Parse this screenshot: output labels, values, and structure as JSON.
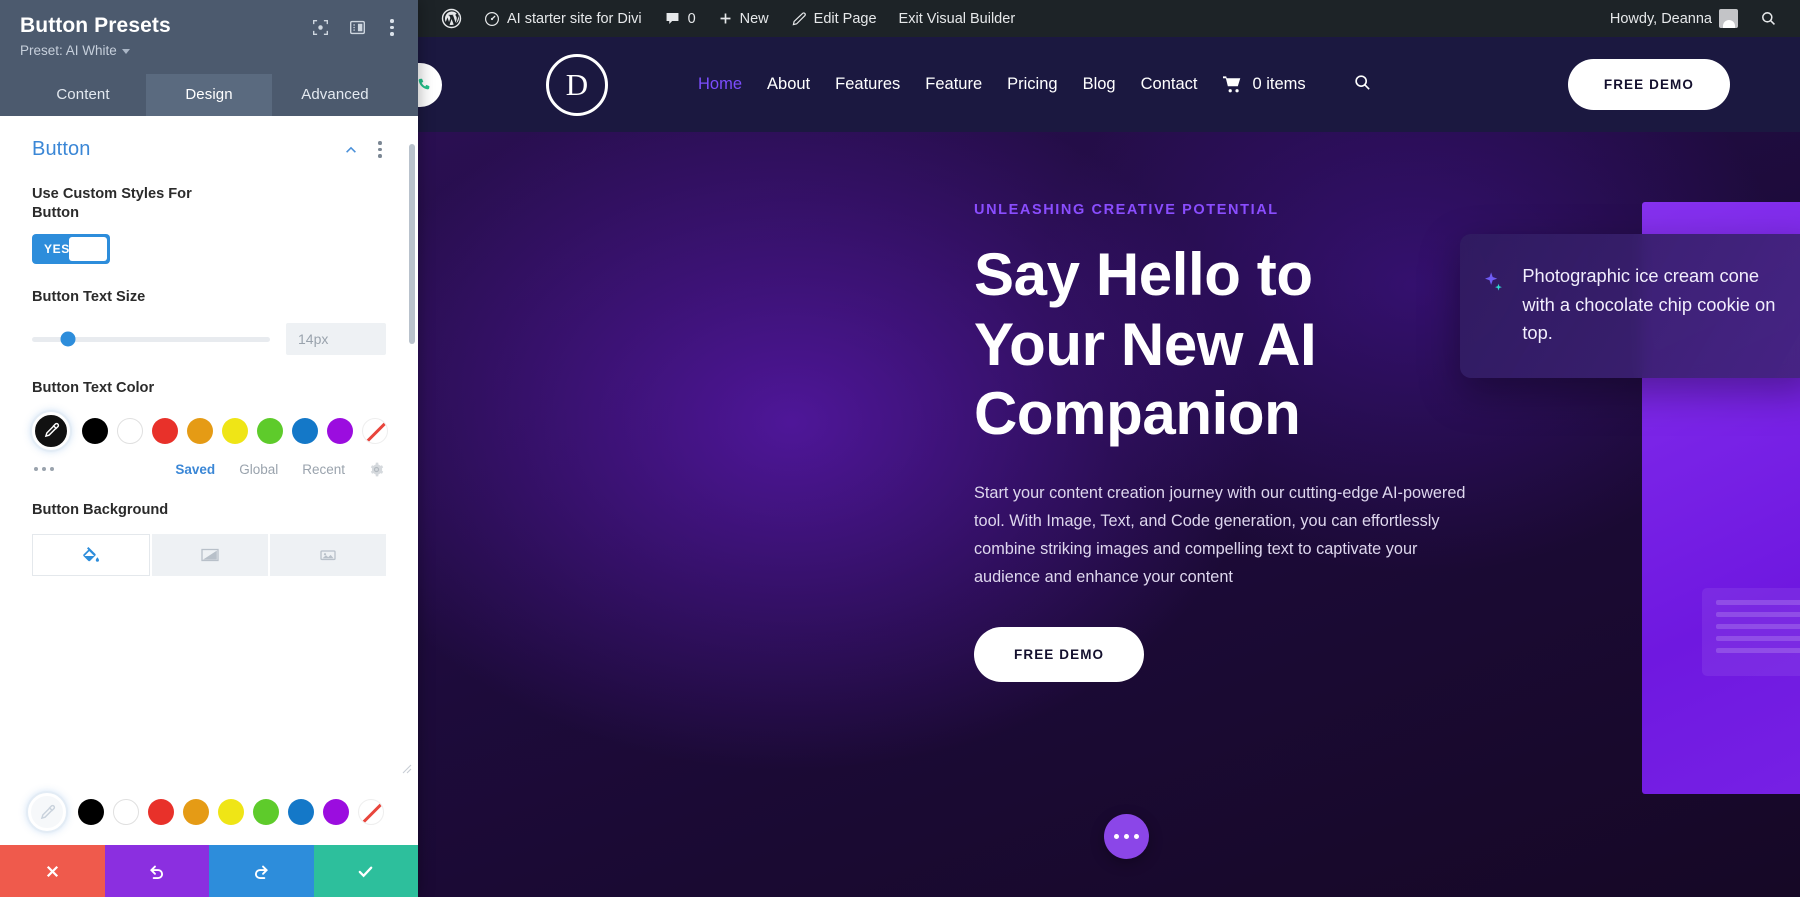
{
  "panel": {
    "title": "Button Presets",
    "preset_label": "Preset: AI White",
    "icons": {
      "focus": "focus-target-icon",
      "layout": "panel-layout-icon",
      "more": "more-options-icon"
    },
    "tabs": [
      {
        "label": "Content",
        "active": false
      },
      {
        "label": "Design",
        "active": true
      },
      {
        "label": "Advanced",
        "active": false
      }
    ],
    "section": {
      "title": "Button",
      "collapse_icon": "chevron-up-icon",
      "more_icon": "more-options-icon"
    },
    "fields": {
      "custom_styles": {
        "label": "Use Custom Styles For Button",
        "toggle_value": "YES"
      },
      "text_size": {
        "label": "Button Text Size",
        "value": "14px",
        "slider_percent": 15
      },
      "text_color": {
        "label": "Button Text Color",
        "swatches": [
          {
            "name": "eyedropper",
            "color": "#111111"
          },
          {
            "name": "black",
            "color": "#000000"
          },
          {
            "name": "white",
            "color": "#ffffff"
          },
          {
            "name": "red",
            "color": "#e8312a"
          },
          {
            "name": "orange",
            "color": "#e59b15"
          },
          {
            "name": "yellow",
            "color": "#efe516"
          },
          {
            "name": "green",
            "color": "#5ecb2b"
          },
          {
            "name": "blue",
            "color": "#1478c8"
          },
          {
            "name": "purple",
            "color": "#9b0ddf"
          },
          {
            "name": "none",
            "color": "#ffffff"
          }
        ],
        "palette_links": [
          {
            "label": "Saved",
            "active": true
          },
          {
            "label": "Global",
            "active": false
          },
          {
            "label": "Recent",
            "active": false
          }
        ],
        "more_icon": "more-dots-icon",
        "settings_icon": "gear-icon"
      },
      "background": {
        "label": "Button Background",
        "tabs": [
          {
            "name": "background-color-tab",
            "icon": "paint-bucket-icon",
            "active": true
          },
          {
            "name": "background-gradient-tab",
            "icon": "gradient-icon",
            "active": false
          },
          {
            "name": "background-image-tab",
            "icon": "image-icon",
            "active": false
          }
        ]
      }
    },
    "footer_swatches": [
      {
        "name": "eyedropper",
        "color": "#f6f8fa"
      },
      {
        "name": "black",
        "color": "#000000"
      },
      {
        "name": "white",
        "color": "#ffffff"
      },
      {
        "name": "red",
        "color": "#e8312a"
      },
      {
        "name": "orange",
        "color": "#e59b15"
      },
      {
        "name": "yellow",
        "color": "#efe516"
      },
      {
        "name": "green",
        "color": "#5ecb2b"
      },
      {
        "name": "blue",
        "color": "#1478c8"
      },
      {
        "name": "purple",
        "color": "#9b0ddf"
      },
      {
        "name": "none",
        "color": "#ffffff"
      }
    ],
    "actions": [
      {
        "name": "cancel-button",
        "icon": "close-icon",
        "color": "#ef5a4c"
      },
      {
        "name": "undo-button",
        "icon": "undo-icon",
        "color": "#8b2fe0"
      },
      {
        "name": "redo-button",
        "icon": "redo-icon",
        "color": "#2d8ddb"
      },
      {
        "name": "save-button",
        "icon": "check-icon",
        "color": "#2dbf9c"
      }
    ]
  },
  "admin_bar": {
    "wp_logo": "wordpress-logo-icon",
    "site_name": "AI starter site for Divi",
    "comment_count": "0",
    "new_label": "New",
    "edit_page_label": "Edit Page",
    "exit_builder_label": "Exit Visual Builder",
    "howdy": "Howdy, Deanna",
    "search_icon": "search-icon"
  },
  "site": {
    "logo_letter": "D",
    "nav": [
      {
        "label": "Home",
        "active": true
      },
      {
        "label": "About",
        "active": false
      },
      {
        "label": "Features",
        "active": false
      },
      {
        "label": "Feature",
        "active": false
      },
      {
        "label": "Pricing",
        "active": false
      },
      {
        "label": "Blog",
        "active": false
      },
      {
        "label": "Contact",
        "active": false
      }
    ],
    "cart_label": "0 items",
    "search_icon": "search-icon",
    "header_cta": "FREE DEMO",
    "hero": {
      "eyebrow": "UNLEASHING CREATIVE POTENTIAL",
      "title_lines": [
        "Say Hello to",
        "Your New AI",
        "Companion"
      ],
      "paragraph": "Start your content creation journey with our cutting-edge AI-powered tool. With Image, Text, and Code generation, you can effortlessly combine striking images and compelling text to captivate your audience and enhance your content",
      "cta": "FREE DEMO",
      "ai_prompt": "Photographic ice cream cone with a chocolate chip cookie on top.",
      "ai_prompt_icon": "sparkle-icon"
    },
    "fab_icon": "more-dots-icon"
  },
  "colors": {
    "panel_header": "#4c5a6e",
    "accent_blue": "#3b87d6",
    "brand_purple": "#7c4dff",
    "site_nav_bg": "#1b1840",
    "card_purple": "#7c2ae8"
  }
}
